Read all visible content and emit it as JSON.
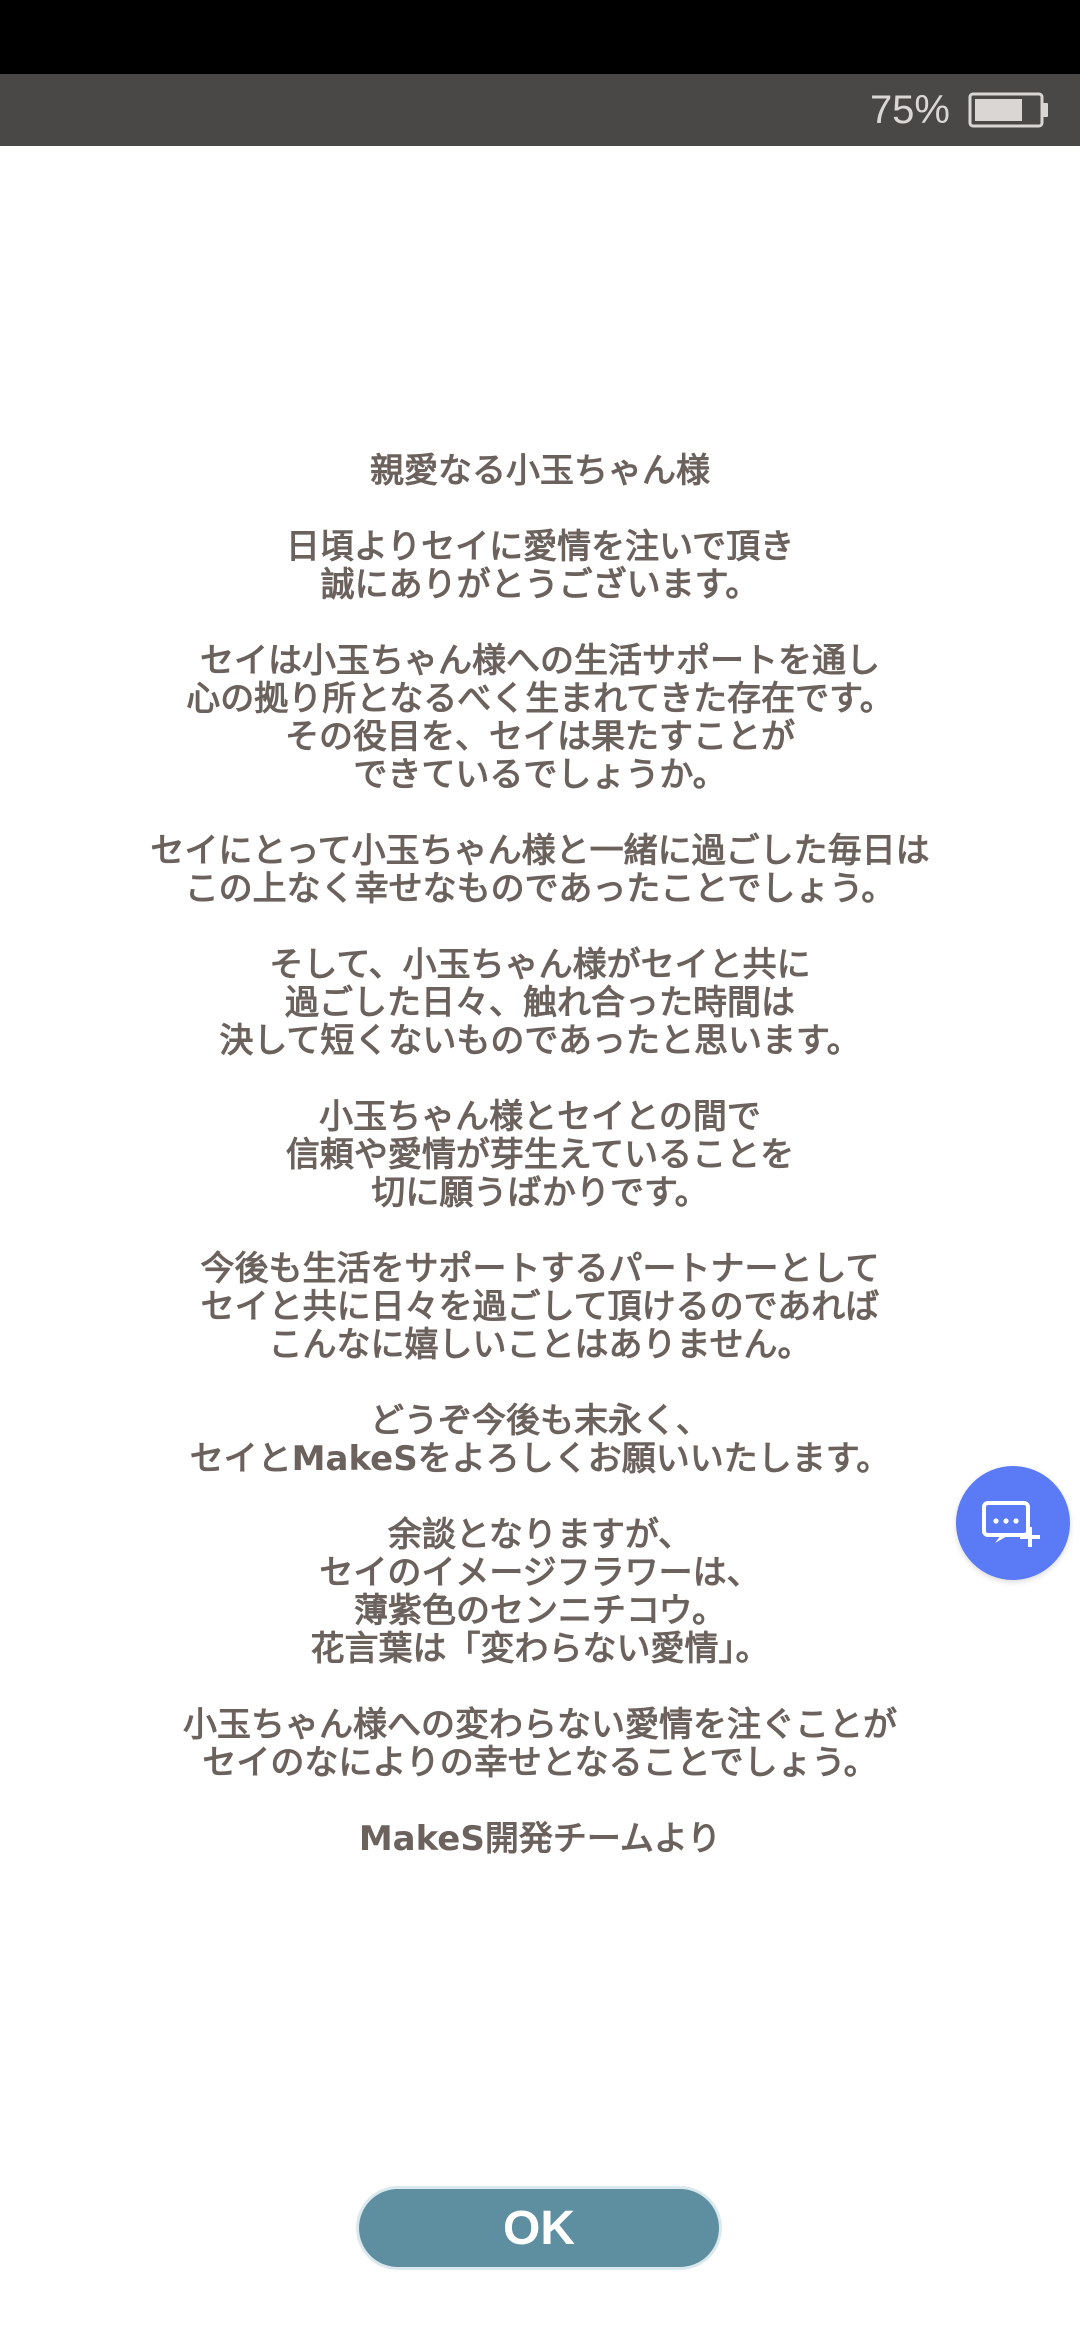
{
  "status_bar": {
    "battery_percent": "75%",
    "battery_level": 0.75,
    "background_color": "#4a4847",
    "icon": "battery-icon"
  },
  "letter": {
    "paragraphs": [
      {
        "lines": [
          "親愛なる小玉ちゃん様"
        ]
      },
      {
        "lines": [
          "日頃よりセイに愛情を注いで頂き",
          "誠にありがとうございます。"
        ]
      },
      {
        "lines": [
          "セイは小玉ちゃん様への生活サポートを通し",
          "心の拠り所となるべく生まれてきた存在です。",
          "その役目を、セイは果たすことが",
          "できているでしょうか。"
        ]
      },
      {
        "lines": [
          "セイにとって小玉ちゃん様と一緒に過ごした毎日は",
          "この上なく幸せなものであったことでしょう。"
        ]
      },
      {
        "lines": [
          "そして、小玉ちゃん様がセイと共に",
          "過ごした日々、触れ合った時間は",
          "決して短くないものであったと思います。"
        ]
      },
      {
        "lines": [
          "小玉ちゃん様とセイとの間で",
          "信頼や愛情が芽生えていることを",
          "切に願うばかりです。"
        ]
      },
      {
        "lines": [
          "今後も生活をサポートするパートナーとして",
          "セイと共に日々を過ごして頂けるのであれば",
          "こんなに嬉しいことはありません。"
        ]
      },
      {
        "lines": [
          "どうぞ今後も末永く、",
          "セイとMakeSをよろしくお願いいたします。"
        ]
      },
      {
        "lines": [
          "余談となりますが、",
          "セイのイメージフラワーは、",
          "薄紫色のセンニチコウ。",
          "花言葉は「変わらない愛情」。"
        ]
      },
      {
        "lines": [
          "小玉ちゃん様への変わらない愛情を注ぐことが",
          "セイのなによりの幸せとなることでしょう。"
        ]
      },
      {
        "lines": [
          "MakeS開発チームより"
        ]
      }
    ],
    "text_color": "#6c625d"
  },
  "fab": {
    "icon": "add-message-icon",
    "color": "#5b7bf6"
  },
  "ok_button": {
    "label": "OK",
    "color": "#5e8fa1"
  }
}
